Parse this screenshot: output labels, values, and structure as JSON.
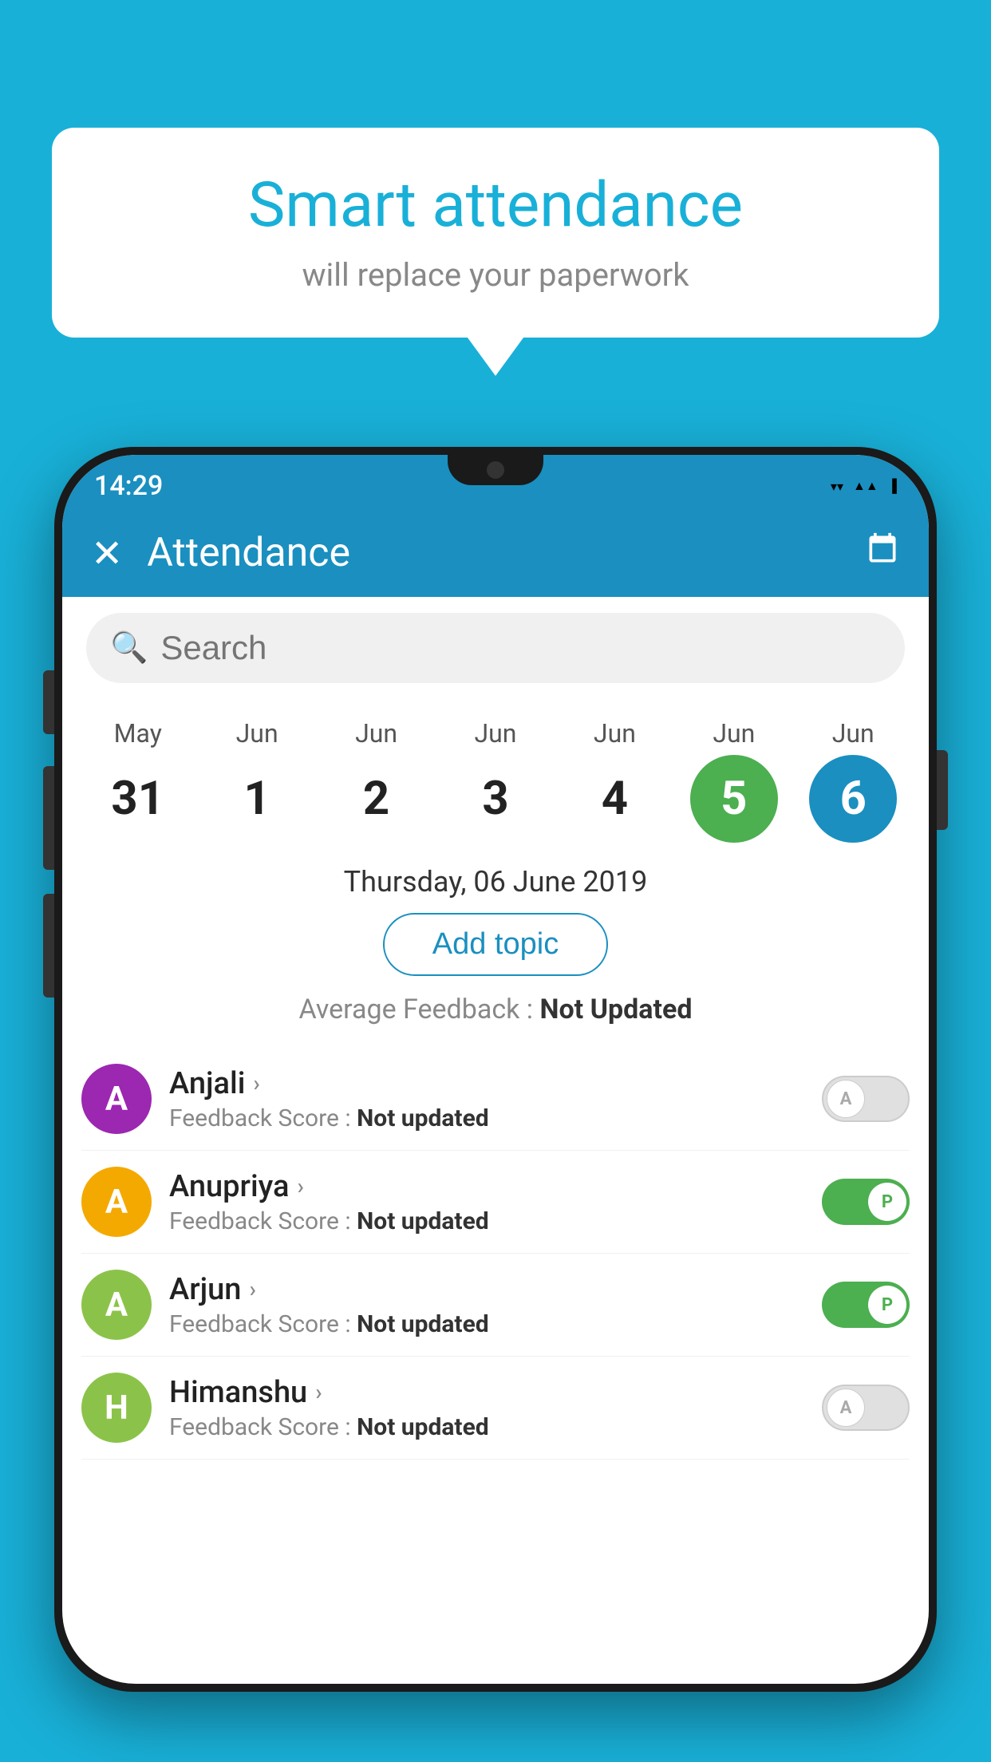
{
  "background_color": "#19b0d8",
  "bubble": {
    "title": "Smart attendance",
    "subtitle": "will replace your paperwork"
  },
  "status_bar": {
    "time": "14:29",
    "wifi": "▼",
    "signal": "▲",
    "battery": "▮"
  },
  "app_bar": {
    "title": "Attendance",
    "close_label": "✕",
    "calendar_label": "📅"
  },
  "search": {
    "placeholder": "Search"
  },
  "calendar": {
    "days": [
      {
        "month": "May",
        "num": "31",
        "state": "normal"
      },
      {
        "month": "Jun",
        "num": "1",
        "state": "normal"
      },
      {
        "month": "Jun",
        "num": "2",
        "state": "normal"
      },
      {
        "month": "Jun",
        "num": "3",
        "state": "normal"
      },
      {
        "month": "Jun",
        "num": "4",
        "state": "normal"
      },
      {
        "month": "Jun",
        "num": "5",
        "state": "today"
      },
      {
        "month": "Jun",
        "num": "6",
        "state": "selected"
      }
    ]
  },
  "selected_date": "Thursday, 06 June 2019",
  "add_topic_label": "Add topic",
  "avg_feedback_label": "Average Feedback :",
  "avg_feedback_value": "Not Updated",
  "students": [
    {
      "name": "Anjali",
      "avatar_letter": "A",
      "avatar_color": "#9c27b0",
      "feedback_label": "Feedback Score :",
      "feedback_value": "Not updated",
      "toggle_state": "off",
      "toggle_label": "A"
    },
    {
      "name": "Anupriya",
      "avatar_letter": "A",
      "avatar_color": "#f4a900",
      "feedback_label": "Feedback Score :",
      "feedback_value": "Not updated",
      "toggle_state": "on",
      "toggle_label": "P"
    },
    {
      "name": "Arjun",
      "avatar_letter": "A",
      "avatar_color": "#8bc34a",
      "feedback_label": "Feedback Score :",
      "feedback_value": "Not updated",
      "toggle_state": "on",
      "toggle_label": "P"
    },
    {
      "name": "Himanshu",
      "avatar_letter": "H",
      "avatar_color": "#8bc34a",
      "feedback_label": "Feedback Score :",
      "feedback_value": "Not updated",
      "toggle_state": "off",
      "toggle_label": "A"
    }
  ]
}
